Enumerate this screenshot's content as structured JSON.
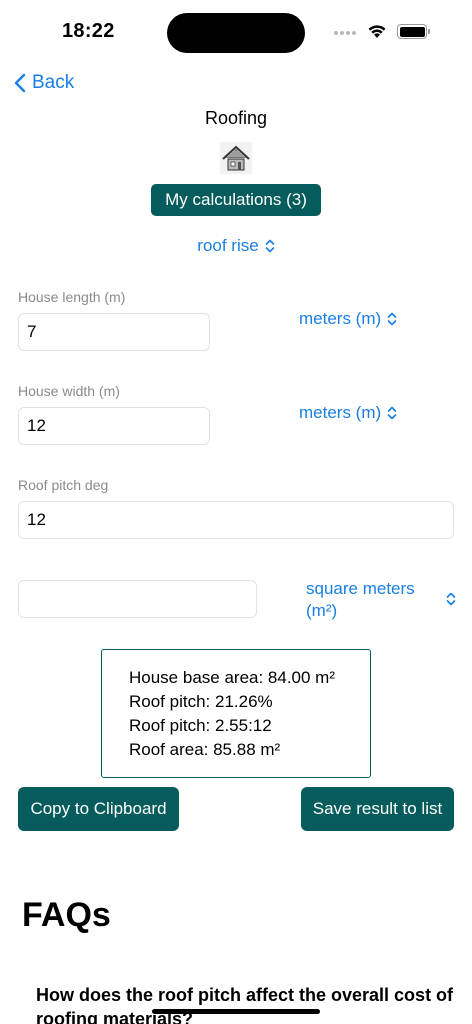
{
  "status": {
    "time": "18:22"
  },
  "nav": {
    "back_label": "Back"
  },
  "page": {
    "title": "Roofing",
    "calculations_button": "My calculations (3)",
    "mode_select": "roof rise"
  },
  "fields": {
    "length": {
      "label": "House length (m)",
      "value": "7",
      "unit": "meters (m)"
    },
    "width": {
      "label": "House width (m)",
      "value": "12",
      "unit": "meters (m)"
    },
    "pitch": {
      "label": "Roof pitch  deg",
      "value": "12"
    },
    "result_unit": {
      "value": "",
      "unit_line1": "square meters",
      "unit_line2": "(m²)"
    }
  },
  "results": [
    "House base area: 84.00 m²",
    "Roof pitch: 21.26%",
    "Roof pitch: 2.55:12",
    "Roof area: 85.88 m²"
  ],
  "actions": {
    "copy": "Copy to Clipboard",
    "save": "Save result to list"
  },
  "faq": {
    "title": "FAQs",
    "question": "How does the roof pitch affect the overall cost of roofing materials?"
  },
  "colors": {
    "accent": "#065c5c",
    "link": "#1a7fe3"
  }
}
